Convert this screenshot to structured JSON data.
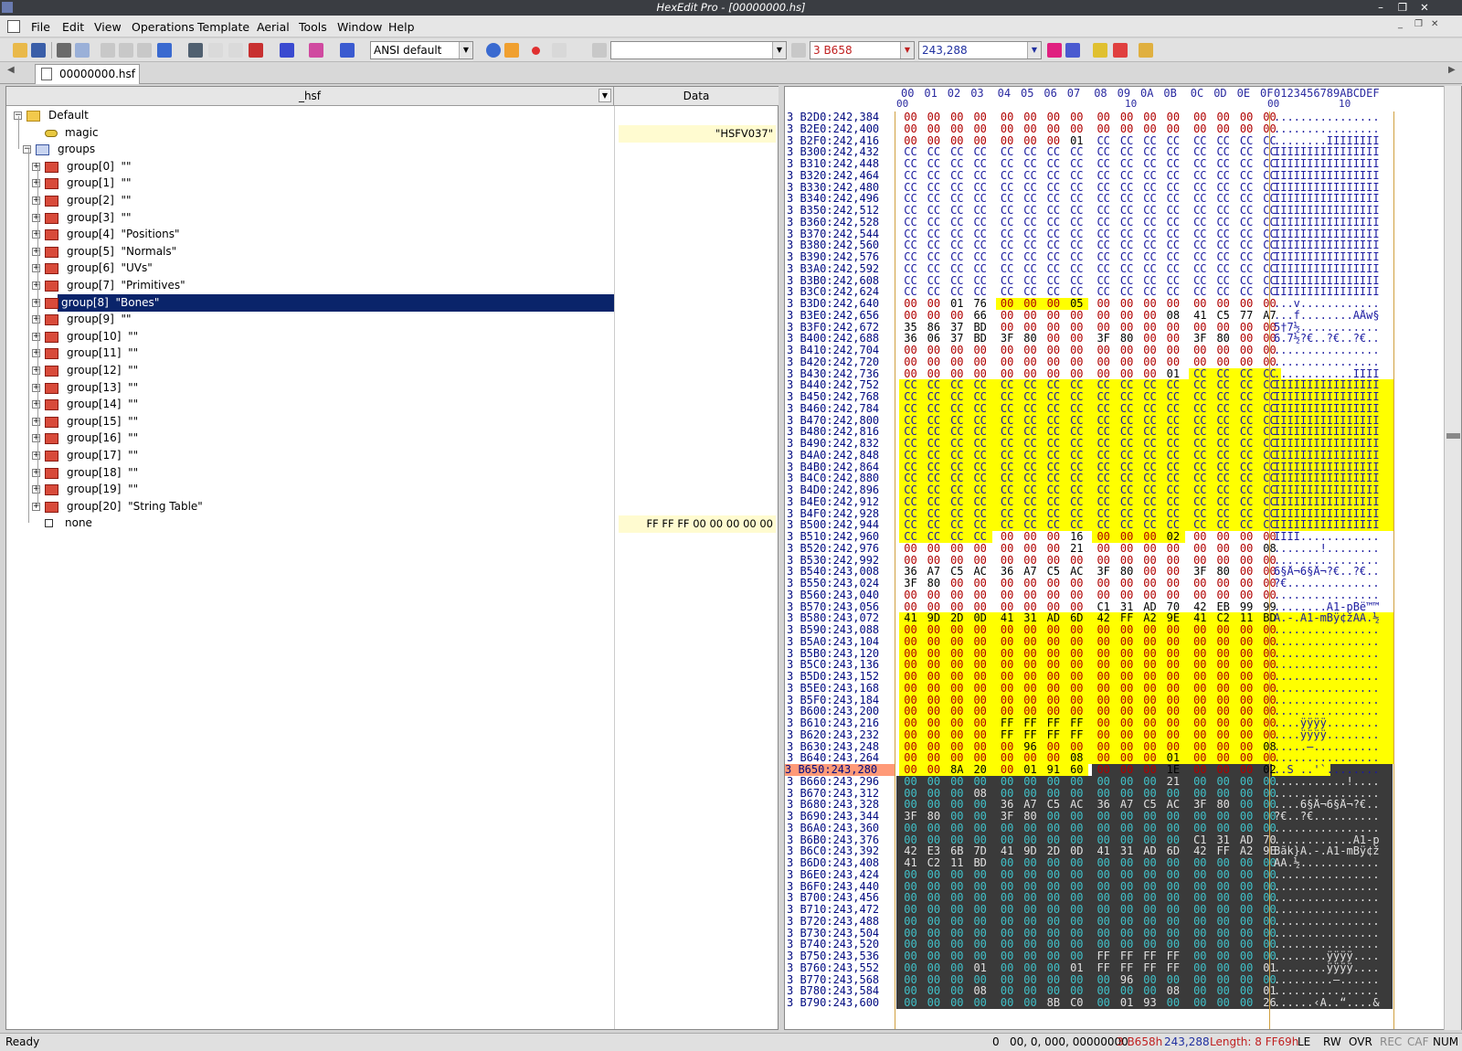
{
  "window": {
    "title": "HexEdit Pro - [00000000.hs]"
  },
  "menu": [
    "File",
    "Edit",
    "View",
    "Operations",
    "Template",
    "Aerial",
    "Tools",
    "Window",
    "Help"
  ],
  "toolbar": {
    "charset": "ANSI default",
    "search_value": "",
    "address_hex": "3 B658",
    "address_dec": "243,288"
  },
  "tab": {
    "label": "00000000.hsf"
  },
  "tree": {
    "col_name": "_hsf",
    "col_data": "Data",
    "items": [
      {
        "label": "Default",
        "indent": 0,
        "icon": "folder-icon",
        "exp": "-",
        "data": ""
      },
      {
        "label": "magic",
        "indent": 1,
        "icon": "string-icon",
        "exp": "",
        "data": "\"HSFV037\""
      },
      {
        "label": "groups",
        "indent": 1,
        "icon": "array-icon",
        "exp": "-",
        "data": ""
      },
      {
        "label": "group[0]  \"\"",
        "indent": 2,
        "icon": "struct-icon",
        "exp": "+",
        "data": ""
      },
      {
        "label": "group[1]  \"\"",
        "indent": 2,
        "icon": "struct-icon",
        "exp": "+",
        "data": ""
      },
      {
        "label": "group[2]  \"\"",
        "indent": 2,
        "icon": "struct-icon",
        "exp": "+",
        "data": ""
      },
      {
        "label": "group[3]  \"\"",
        "indent": 2,
        "icon": "struct-icon",
        "exp": "+",
        "data": ""
      },
      {
        "label": "group[4]  \"Positions\"",
        "indent": 2,
        "icon": "struct-icon",
        "exp": "+",
        "data": ""
      },
      {
        "label": "group[5]  \"Normals\"",
        "indent": 2,
        "icon": "struct-icon",
        "exp": "+",
        "data": ""
      },
      {
        "label": "group[6]  \"UVs\"",
        "indent": 2,
        "icon": "struct-icon",
        "exp": "+",
        "data": ""
      },
      {
        "label": "group[7]  \"Primitives\"",
        "indent": 2,
        "icon": "struct-icon",
        "exp": "+",
        "data": ""
      },
      {
        "label": "group[8]  \"Bones\"",
        "indent": 2,
        "icon": "struct-icon",
        "exp": "+",
        "data": "",
        "selected": true
      },
      {
        "label": "group[9]  \"\"",
        "indent": 2,
        "icon": "struct-icon",
        "exp": "+",
        "data": ""
      },
      {
        "label": "group[10]  \"\"",
        "indent": 2,
        "icon": "struct-icon",
        "exp": "+",
        "data": ""
      },
      {
        "label": "group[11]  \"\"",
        "indent": 2,
        "icon": "struct-icon",
        "exp": "+",
        "data": ""
      },
      {
        "label": "group[12]  \"\"",
        "indent": 2,
        "icon": "struct-icon",
        "exp": "+",
        "data": ""
      },
      {
        "label": "group[13]  \"\"",
        "indent": 2,
        "icon": "struct-icon",
        "exp": "+",
        "data": ""
      },
      {
        "label": "group[14]  \"\"",
        "indent": 2,
        "icon": "struct-icon",
        "exp": "+",
        "data": ""
      },
      {
        "label": "group[15]  \"\"",
        "indent": 2,
        "icon": "struct-icon",
        "exp": "+",
        "data": ""
      },
      {
        "label": "group[16]  \"\"",
        "indent": 2,
        "icon": "struct-icon",
        "exp": "+",
        "data": ""
      },
      {
        "label": "group[17]  \"\"",
        "indent": 2,
        "icon": "struct-icon",
        "exp": "+",
        "data": ""
      },
      {
        "label": "group[18]  \"\"",
        "indent": 2,
        "icon": "struct-icon",
        "exp": "+",
        "data": ""
      },
      {
        "label": "group[19]  \"\"",
        "indent": 2,
        "icon": "struct-icon",
        "exp": "+",
        "data": ""
      },
      {
        "label": "group[20]  \"String Table\"",
        "indent": 2,
        "icon": "struct-icon",
        "exp": "+",
        "data": ""
      },
      {
        "label": "none",
        "indent": 1,
        "icon": "empty-icon",
        "exp": "",
        "data": "FF FF FF 00 00 00 00 00"
      }
    ]
  },
  "hex": {
    "ruler_cols": [
      "00",
      "01",
      "02",
      "03",
      "04",
      "05",
      "06",
      "07",
      "08",
      "09",
      "0A",
      "0B",
      "0C",
      "0D",
      "0E",
      "0F"
    ],
    "ruler_ascii": "0123456789ABCDEF",
    "ruler_sub": [
      "00",
      "10",
      "00",
      "10"
    ],
    "rows": [
      {
        "a": "3 B2D0:242,384",
        "h": "00 00 00 00 00 00 00 00 00 00 00 00 00 00 00 00",
        "t": "................",
        "m": "n"
      },
      {
        "a": "3 B2E0:242,400",
        "h": "00 00 00 00 00 00 00 00 00 00 00 00 00 00 00 00",
        "t": "................",
        "m": "n"
      },
      {
        "a": "3 B2F0:242,416",
        "h": "00 00 00 00 00 00 00 01 CC CC CC CC CC CC CC CC",
        "t": "........ÌÌÌÌÌÌÌÌ",
        "m": "n"
      },
      {
        "a": "3 B300:242,432",
        "h": "CC CC CC CC CC CC CC CC CC CC CC CC CC CC CC CC",
        "t": "ÌÌÌÌÌÌÌÌÌÌÌÌÌÌÌÌ",
        "m": "n"
      },
      {
        "a": "3 B310:242,448",
        "h": "CC CC CC CC CC CC CC CC CC CC CC CC CC CC CC CC",
        "t": "ÌÌÌÌÌÌÌÌÌÌÌÌÌÌÌÌ",
        "m": "n"
      },
      {
        "a": "3 B320:242,464",
        "h": "CC CC CC CC CC CC CC CC CC CC CC CC CC CC CC CC",
        "t": "ÌÌÌÌÌÌÌÌÌÌÌÌÌÌÌÌ",
        "m": "n"
      },
      {
        "a": "3 B330:242,480",
        "h": "CC CC CC CC CC CC CC CC CC CC CC CC CC CC CC CC",
        "t": "ÌÌÌÌÌÌÌÌÌÌÌÌÌÌÌÌ",
        "m": "n"
      },
      {
        "a": "3 B340:242,496",
        "h": "CC CC CC CC CC CC CC CC CC CC CC CC CC CC CC CC",
        "t": "ÌÌÌÌÌÌÌÌÌÌÌÌÌÌÌÌ",
        "m": "n"
      },
      {
        "a": "3 B350:242,512",
        "h": "CC CC CC CC CC CC CC CC CC CC CC CC CC CC CC CC",
        "t": "ÌÌÌÌÌÌÌÌÌÌÌÌÌÌÌÌ",
        "m": "n"
      },
      {
        "a": "3 B360:242,528",
        "h": "CC CC CC CC CC CC CC CC CC CC CC CC CC CC CC CC",
        "t": "ÌÌÌÌÌÌÌÌÌÌÌÌÌÌÌÌ",
        "m": "n"
      },
      {
        "a": "3 B370:242,544",
        "h": "CC CC CC CC CC CC CC CC CC CC CC CC CC CC CC CC",
        "t": "ÌÌÌÌÌÌÌÌÌÌÌÌÌÌÌÌ",
        "m": "n"
      },
      {
        "a": "3 B380:242,560",
        "h": "CC CC CC CC CC CC CC CC CC CC CC CC CC CC CC CC",
        "t": "ÌÌÌÌÌÌÌÌÌÌÌÌÌÌÌÌ",
        "m": "n"
      },
      {
        "a": "3 B390:242,576",
        "h": "CC CC CC CC CC CC CC CC CC CC CC CC CC CC CC CC",
        "t": "ÌÌÌÌÌÌÌÌÌÌÌÌÌÌÌÌ",
        "m": "n"
      },
      {
        "a": "3 B3A0:242,592",
        "h": "CC CC CC CC CC CC CC CC CC CC CC CC CC CC CC CC",
        "t": "ÌÌÌÌÌÌÌÌÌÌÌÌÌÌÌÌ",
        "m": "n"
      },
      {
        "a": "3 B3B0:242,608",
        "h": "CC CC CC CC CC CC CC CC CC CC CC CC CC CC CC CC",
        "t": "ÌÌÌÌÌÌÌÌÌÌÌÌÌÌÌÌ",
        "m": "n"
      },
      {
        "a": "3 B3C0:242,624",
        "h": "CC CC CC CC CC CC CC CC CC CC CC CC CC CC CC CC",
        "t": "ÌÌÌÌÌÌÌÌÌÌÌÌÌÌÌÌ",
        "m": "n"
      },
      {
        "a": "3 B3D0:242,640",
        "h": "00 00 01 76 00 00 00 05 00 00 00 00 00 00 00 00",
        "t": "...v............",
        "m": "p",
        "s": 4,
        "e": 7
      },
      {
        "a": "3 B3E0:242,656",
        "h": "00 00 00 66 00 00 00 00 00 00 00 08 41 C5 77 A7",
        "t": "...f........AÅw§",
        "m": "n"
      },
      {
        "a": "3 B3F0:242,672",
        "h": "35 86 37 BD 00 00 00 00 00 00 00 00 00 00 00 00",
        "t": "5†7½............",
        "m": "n"
      },
      {
        "a": "3 B400:242,688",
        "h": "36 06 37 BD 3F 80 00 00 3F 80 00 00 3F 80 00 00",
        "t": "6.7½?€..?€..?€..",
        "m": "n"
      },
      {
        "a": "3 B410:242,704",
        "h": "00 00 00 00 00 00 00 00 00 00 00 00 00 00 00 00",
        "t": "................",
        "m": "n"
      },
      {
        "a": "3 B420:242,720",
        "h": "00 00 00 00 00 00 00 00 00 00 00 00 00 00 00 00",
        "t": "................",
        "m": "n"
      },
      {
        "a": "3 B430:242,736",
        "h": "00 00 00 00 00 00 00 00 00 00 00 01 CC CC CC CC",
        "t": "............ÌÌÌÌ",
        "m": "p",
        "s": 12,
        "e": 15
      },
      {
        "a": "3 B440:242,752",
        "h": "CC CC CC CC CC CC CC CC CC CC CC CC CC CC CC CC",
        "t": "ÌÌÌÌÌÌÌÌÌÌÌÌÌÌÌÌ",
        "m": "y"
      },
      {
        "a": "3 B450:242,768",
        "h": "CC CC CC CC CC CC CC CC CC CC CC CC CC CC CC CC",
        "t": "ÌÌÌÌÌÌÌÌÌÌÌÌÌÌÌÌ",
        "m": "y"
      },
      {
        "a": "3 B460:242,784",
        "h": "CC CC CC CC CC CC CC CC CC CC CC CC CC CC CC CC",
        "t": "ÌÌÌÌÌÌÌÌÌÌÌÌÌÌÌÌ",
        "m": "y"
      },
      {
        "a": "3 B470:242,800",
        "h": "CC CC CC CC CC CC CC CC CC CC CC CC CC CC CC CC",
        "t": "ÌÌÌÌÌÌÌÌÌÌÌÌÌÌÌÌ",
        "m": "y"
      },
      {
        "a": "3 B480:242,816",
        "h": "CC CC CC CC CC CC CC CC CC CC CC CC CC CC CC CC",
        "t": "ÌÌÌÌÌÌÌÌÌÌÌÌÌÌÌÌ",
        "m": "y"
      },
      {
        "a": "3 B490:242,832",
        "h": "CC CC CC CC CC CC CC CC CC CC CC CC CC CC CC CC",
        "t": "ÌÌÌÌÌÌÌÌÌÌÌÌÌÌÌÌ",
        "m": "y"
      },
      {
        "a": "3 B4A0:242,848",
        "h": "CC CC CC CC CC CC CC CC CC CC CC CC CC CC CC CC",
        "t": "ÌÌÌÌÌÌÌÌÌÌÌÌÌÌÌÌ",
        "m": "y"
      },
      {
        "a": "3 B4B0:242,864",
        "h": "CC CC CC CC CC CC CC CC CC CC CC CC CC CC CC CC",
        "t": "ÌÌÌÌÌÌÌÌÌÌÌÌÌÌÌÌ",
        "m": "y"
      },
      {
        "a": "3 B4C0:242,880",
        "h": "CC CC CC CC CC CC CC CC CC CC CC CC CC CC CC CC",
        "t": "ÌÌÌÌÌÌÌÌÌÌÌÌÌÌÌÌ",
        "m": "y"
      },
      {
        "a": "3 B4D0:242,896",
        "h": "CC CC CC CC CC CC CC CC CC CC CC CC CC CC CC CC",
        "t": "ÌÌÌÌÌÌÌÌÌÌÌÌÌÌÌÌ",
        "m": "y"
      },
      {
        "a": "3 B4E0:242,912",
        "h": "CC CC CC CC CC CC CC CC CC CC CC CC CC CC CC CC",
        "t": "ÌÌÌÌÌÌÌÌÌÌÌÌÌÌÌÌ",
        "m": "y"
      },
      {
        "a": "3 B4F0:242,928",
        "h": "CC CC CC CC CC CC CC CC CC CC CC CC CC CC CC CC",
        "t": "ÌÌÌÌÌÌÌÌÌÌÌÌÌÌÌÌ",
        "m": "y"
      },
      {
        "a": "3 B500:242,944",
        "h": "CC CC CC CC CC CC CC CC CC CC CC CC CC CC CC CC",
        "t": "ÌÌÌÌÌÌÌÌÌÌÌÌÌÌÌÌ",
        "m": "y"
      },
      {
        "a": "3 B510:242,960",
        "h": "CC CC CC CC 00 00 00 16 00 00 00 02 00 00 00 00",
        "t": "ÌÌÌÌ............",
        "m": "p",
        "s": 0,
        "e": 3,
        "s2": 8,
        "e2": 11
      },
      {
        "a": "3 B520:242,976",
        "h": "00 00 00 00 00 00 00 21 00 00 00 00 00 00 00 08",
        "t": ".......!........",
        "m": "n"
      },
      {
        "a": "3 B530:242,992",
        "h": "00 00 00 00 00 00 00 00 00 00 00 00 00 00 00 00",
        "t": "................",
        "m": "n"
      },
      {
        "a": "3 B540:243,008",
        "h": "36 A7 C5 AC 36 A7 C5 AC 3F 80 00 00 3F 80 00 00",
        "t": "6§Å¬6§Å¬?€..?€..",
        "m": "n"
      },
      {
        "a": "3 B550:243,024",
        "h": "3F 80 00 00 00 00 00 00 00 00 00 00 00 00 00 00",
        "t": "?€..............",
        "m": "n"
      },
      {
        "a": "3 B560:243,040",
        "h": "00 00 00 00 00 00 00 00 00 00 00 00 00 00 00 00",
        "t": "................",
        "m": "n"
      },
      {
        "a": "3 B570:243,056",
        "h": "00 00 00 00 00 00 00 00 C1 31 AD 70 42 EB 99 99",
        "t": "........Á1-pBë™™",
        "m": "n"
      },
      {
        "a": "3 B580:243,072",
        "h": "41 9D 2D 0D 41 31 AD 6D 42 FF A2 9E 41 C2 11 BD",
        "t": "A.-.A1-mBÿ¢žAÂ.½",
        "m": "y"
      },
      {
        "a": "3 B590:243,088",
        "h": "00 00 00 00 00 00 00 00 00 00 00 00 00 00 00 00",
        "t": "................",
        "m": "y"
      },
      {
        "a": "3 B5A0:243,104",
        "h": "00 00 00 00 00 00 00 00 00 00 00 00 00 00 00 00",
        "t": "................",
        "m": "y"
      },
      {
        "a": "3 B5B0:243,120",
        "h": "00 00 00 00 00 00 00 00 00 00 00 00 00 00 00 00",
        "t": "................",
        "m": "y"
      },
      {
        "a": "3 B5C0:243,136",
        "h": "00 00 00 00 00 00 00 00 00 00 00 00 00 00 00 00",
        "t": "................",
        "m": "y"
      },
      {
        "a": "3 B5D0:243,152",
        "h": "00 00 00 00 00 00 00 00 00 00 00 00 00 00 00 00",
        "t": "................",
        "m": "y"
      },
      {
        "a": "3 B5E0:243,168",
        "h": "00 00 00 00 00 00 00 00 00 00 00 00 00 00 00 00",
        "t": "................",
        "m": "y"
      },
      {
        "a": "3 B5F0:243,184",
        "h": "00 00 00 00 00 00 00 00 00 00 00 00 00 00 00 00",
        "t": "................",
        "m": "y"
      },
      {
        "a": "3 B600:243,200",
        "h": "00 00 00 00 00 00 00 00 00 00 00 00 00 00 00 00",
        "t": "................",
        "m": "y"
      },
      {
        "a": "3 B610:243,216",
        "h": "00 00 00 00 FF FF FF FF 00 00 00 00 00 00 00 00",
        "t": "....ÿÿÿÿ........",
        "m": "y"
      },
      {
        "a": "3 B620:243,232",
        "h": "00 00 00 00 FF FF FF FF 00 00 00 00 00 00 00 00",
        "t": "....ÿÿÿÿ........",
        "m": "y"
      },
      {
        "a": "3 B630:243,248",
        "h": "00 00 00 00 00 96 00 00 00 00 00 00 00 00 00 08",
        "t": ".....–..........",
        "m": "y"
      },
      {
        "a": "3 B640:243,264",
        "h": "00 00 00 00 00 00 00 08 00 00 00 01 00 00 00 00",
        "t": "................",
        "m": "y"
      },
      {
        "a": "3 B650:243,280",
        "h": "00 00 8A 20 00 01 91 60 00 00 00 1E 00 00 00 02",
        "t": "..Š ..'`........",
        "m": "c"
      },
      {
        "a": "3 B660:243,296",
        "h": "00 00 00 00 00 00 00 00 00 00 00 21 00 00 00 00",
        "t": "...........!....",
        "m": "d"
      },
      {
        "a": "3 B670:243,312",
        "h": "00 00 00 08 00 00 00 00 00 00 00 00 00 00 00 00",
        "t": "................",
        "m": "d"
      },
      {
        "a": "3 B680:243,328",
        "h": "00 00 00 00 36 A7 C5 AC 36 A7 C5 AC 3F 80 00 00",
        "t": "....6§Å¬6§Å¬?€..",
        "m": "d"
      },
      {
        "a": "3 B690:243,344",
        "h": "3F 80 00 00 3F 80 00 00 00 00 00 00 00 00 00 00",
        "t": "?€..?€..........",
        "m": "d"
      },
      {
        "a": "3 B6A0:243,360",
        "h": "00 00 00 00 00 00 00 00 00 00 00 00 00 00 00 00",
        "t": "................",
        "m": "d"
      },
      {
        "a": "3 B6B0:243,376",
        "h": "00 00 00 00 00 00 00 00 00 00 00 00 C1 31 AD 70",
        "t": "............Á1-p",
        "m": "d"
      },
      {
        "a": "3 B6C0:243,392",
        "h": "42 E3 6B 7D 41 9D 2D 0D 41 31 AD 6D 42 FF A2 9E",
        "t": "Bãk}A.-.A1-mBÿ¢ž",
        "m": "d"
      },
      {
        "a": "3 B6D0:243,408",
        "h": "41 C2 11 BD 00 00 00 00 00 00 00 00 00 00 00 00",
        "t": "AÂ.½............",
        "m": "d"
      },
      {
        "a": "3 B6E0:243,424",
        "h": "00 00 00 00 00 00 00 00 00 00 00 00 00 00 00 00",
        "t": "................",
        "m": "d"
      },
      {
        "a": "3 B6F0:243,440",
        "h": "00 00 00 00 00 00 00 00 00 00 00 00 00 00 00 00",
        "t": "................",
        "m": "d"
      },
      {
        "a": "3 B700:243,456",
        "h": "00 00 00 00 00 00 00 00 00 00 00 00 00 00 00 00",
        "t": "................",
        "m": "d"
      },
      {
        "a": "3 B710:243,472",
        "h": "00 00 00 00 00 00 00 00 00 00 00 00 00 00 00 00",
        "t": "................",
        "m": "d"
      },
      {
        "a": "3 B720:243,488",
        "h": "00 00 00 00 00 00 00 00 00 00 00 00 00 00 00 00",
        "t": "................",
        "m": "d"
      },
      {
        "a": "3 B730:243,504",
        "h": "00 00 00 00 00 00 00 00 00 00 00 00 00 00 00 00",
        "t": "................",
        "m": "d"
      },
      {
        "a": "3 B740:243,520",
        "h": "00 00 00 00 00 00 00 00 00 00 00 00 00 00 00 00",
        "t": "................",
        "m": "d"
      },
      {
        "a": "3 B750:243,536",
        "h": "00 00 00 00 00 00 00 00 FF FF FF FF 00 00 00 00",
        "t": "........ÿÿÿÿ....",
        "m": "d"
      },
      {
        "a": "3 B760:243,552",
        "h": "00 00 00 01 00 00 00 01 FF FF FF FF 00 00 00 01",
        "t": "........ÿÿÿÿ....",
        "m": "d"
      },
      {
        "a": "3 B770:243,568",
        "h": "00 00 00 00 00 00 00 00 00 96 00 00 00 00 00 00",
        "t": ".........–......",
        "m": "d"
      },
      {
        "a": "3 B780:243,584",
        "h": "00 00 00 08 00 00 00 00 00 00 00 08 00 00 00 01",
        "t": "................",
        "m": "d"
      },
      {
        "a": "3 B790:243,600",
        "h": "00 00 00 00 00 00 8B C0 00 01 93 00 00 00 00 26",
        "t": "......‹À..“....&",
        "m": "d"
      }
    ]
  },
  "status": {
    "ready": "Ready",
    "count": "0",
    "cursor": "00, 0, 000, 00000000",
    "sel_hex": "3 B658h",
    "sel_dec": "243,288",
    "length": "Length: 8 FF69h",
    "flags": [
      "LE",
      "RW",
      "OVR",
      "REC",
      "CAF",
      "NUM"
    ]
  },
  "colors": {
    "yellow": "#ffff00",
    "selection": "#0a246a",
    "darkbg": "#3a3a3a",
    "current_row": "#ff9a78"
  }
}
